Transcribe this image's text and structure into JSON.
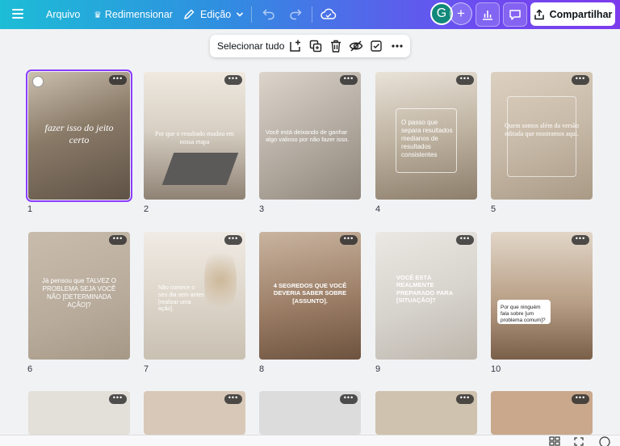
{
  "topbar": {
    "file_label": "Arquivo",
    "resize_label": "Redimensionar",
    "edit_label": "Edição",
    "avatar_letter": "G",
    "share_label": "Compartilhar"
  },
  "floating_toolbar": {
    "select_all_label": "Selecionar tudo"
  },
  "pages": [
    {
      "number": "1",
      "bg": "#8a7a68",
      "selected": true,
      "text": "fazer isso do jeito certo"
    },
    {
      "number": "2",
      "bg": "#d8d0c4",
      "selected": false,
      "text": "Por que o resultado mudou em nossa etapa"
    },
    {
      "number": "3",
      "bg": "#b6aea4",
      "selected": false,
      "text": "Você está deixando de ganhar algo valioso por não fazer isso."
    },
    {
      "number": "4",
      "bg": "#bfb3a1",
      "selected": false,
      "text": "O passo que separa resultados medianos de resultados consistentes"
    },
    {
      "number": "5",
      "bg": "#c8baa8",
      "selected": false,
      "text": "Quem somos além da versão editada que mostramos aqui."
    },
    {
      "number": "6",
      "bg": "#b8ab9b",
      "selected": false,
      "text": "Já pensou que TALVEZ O PROBLEMA SEJA VOCÊ NÃO [DETERMINADA AÇÃO]?"
    },
    {
      "number": "7",
      "bg": "#dcd4c8",
      "selected": false,
      "text": "Não comece o seu dia sem antes [realizar uma ação]."
    },
    {
      "number": "8",
      "bg": "#9c7e66",
      "selected": false,
      "text": "4 SEGREDOS QUE VOCÊ DEVERIA SABER SOBRE [ASSUNTO]."
    },
    {
      "number": "9",
      "bg": "#d6d2cc",
      "selected": false,
      "text": "VOCÊ ESTÁ REALMENTE PREPARADO PARA [SITUAÇÃO]?"
    },
    {
      "number": "10",
      "bg": "#b89f86",
      "selected": false,
      "text": "Por que ninguém fala sobre [um problema comum]?"
    }
  ],
  "partial_row_colors": [
    "#e3dfd9",
    "#d8c8b8",
    "#dcdcdc",
    "#cfc2ae",
    "#c9a88c"
  ]
}
